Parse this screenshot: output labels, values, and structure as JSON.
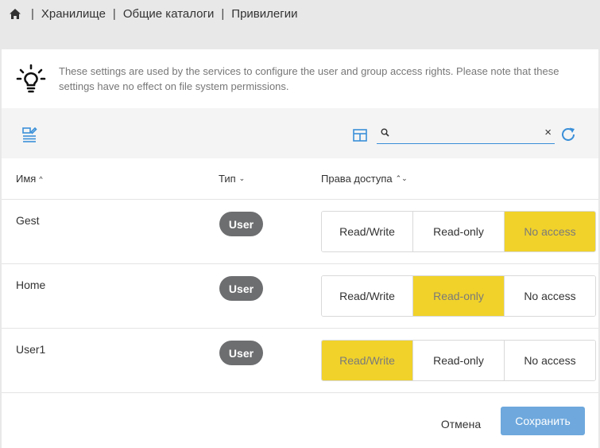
{
  "breadcrumb": {
    "home_icon": "home-icon",
    "items": [
      "Хранилище",
      "Общие каталоги",
      "Привилегии"
    ],
    "separator": "|"
  },
  "info": {
    "icon": "lightbulb-icon",
    "text": "These settings are used by the services to configure the user and group access rights. Please note that these settings have no effect on file system permissions."
  },
  "toolbar": {
    "left_icon": "edit-list-icon",
    "grid_icon": "table-view-icon",
    "search_placeholder": "",
    "search_value": "",
    "clear_glyph": "×",
    "refresh_icon": "refresh-icon"
  },
  "table": {
    "columns": {
      "name": "Имя",
      "name_sort": "^",
      "type": "Тип",
      "type_sort": "⌄",
      "access": "Права доступа",
      "access_sort": "⌃⌄"
    },
    "rows": [
      {
        "name": "Gest",
        "type": "User",
        "options": [
          "Read/Write",
          "Read-only",
          "No access"
        ],
        "selected": "No access"
      },
      {
        "name": "Home",
        "type": "User",
        "options": [
          "Read/Write",
          "Read-only",
          "No access"
        ],
        "selected": "Read-only"
      },
      {
        "name": "User1",
        "type": "User",
        "options": [
          "Read/Write",
          "Read-only",
          "No access"
        ],
        "selected": "Read/Write"
      }
    ]
  },
  "footer": {
    "cancel": "Отмена",
    "save": "Сохранить"
  },
  "colors": {
    "accent_yellow": "#f1d22a",
    "accent_blue": "#3a8fd8",
    "save_button": "#6ea8dd",
    "badge": "#6d6e70"
  }
}
